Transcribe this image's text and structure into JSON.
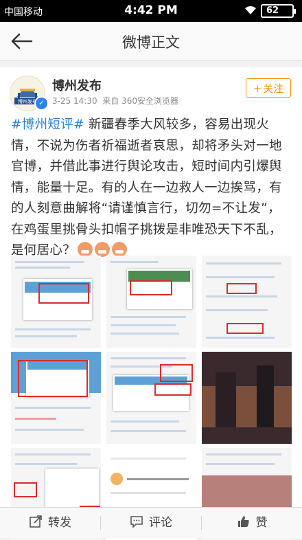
{
  "status": {
    "carrier": "中国移动",
    "time": "4:42 PM",
    "battery": "62"
  },
  "nav": {
    "title": "微博正文"
  },
  "post": {
    "author": "博州发布",
    "avatar_text": "博州发布",
    "date": "3-25 14:30",
    "source": "来自 360安全浏览器",
    "follow_label": "关注",
    "hashtag": "#博州短评#",
    "body": " 新疆春季大风较多，容易出现火情，不说为伤者祈福逝者哀思，却将矛头对一地官博，并借此事进行舆论攻击，短时间内引爆舆情，能量十足。有的人在一边救人一边挨骂，有的人刻意曲解将“请谨慎言行，切勿=不让发”，在鸡蛋里挑骨头扣帽子挑拨是非唯恐天下不乱，是何居心？",
    "emoji": [
      "angry-emoji",
      "angry-emoji",
      "angry-emoji"
    ]
  },
  "images": [
    {
      "name": "screenshot-1"
    },
    {
      "name": "screenshot-2"
    },
    {
      "name": "screenshot-3"
    },
    {
      "name": "screenshot-4"
    },
    {
      "name": "screenshot-5"
    },
    {
      "name": "screenshot-6"
    },
    {
      "name": "screenshot-7"
    },
    {
      "name": "screenshot-8"
    },
    {
      "name": "screenshot-9"
    }
  ],
  "actions": {
    "repost": "转发",
    "comment": "评论",
    "like": "赞"
  }
}
